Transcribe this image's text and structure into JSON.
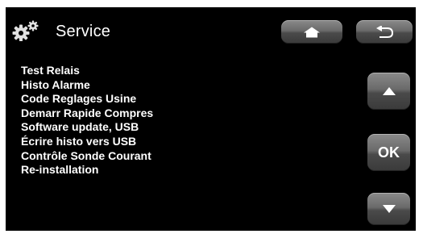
{
  "header": {
    "title": "Service",
    "icon": "gears-icon",
    "home_icon": "home-icon",
    "back_icon": "back-arrow-icon"
  },
  "menu": {
    "items": [
      {
        "label": "Test Relais"
      },
      {
        "label": "Histo Alarme"
      },
      {
        "label": "Code Reglages Usine"
      },
      {
        "label": "Demarr Rapide Compres"
      },
      {
        "label": "Software update, USB"
      },
      {
        "label": "Écrire histo vers USB"
      },
      {
        "label": "Contrôle Sonde Courant"
      },
      {
        "label": "Re-installation"
      }
    ]
  },
  "controls": {
    "up_icon": "triangle-up-icon",
    "ok_label": "OK",
    "down_icon": "triangle-down-icon"
  },
  "colors": {
    "background": "#000000",
    "text": "#ffffff",
    "button": "#6a6a6a"
  }
}
